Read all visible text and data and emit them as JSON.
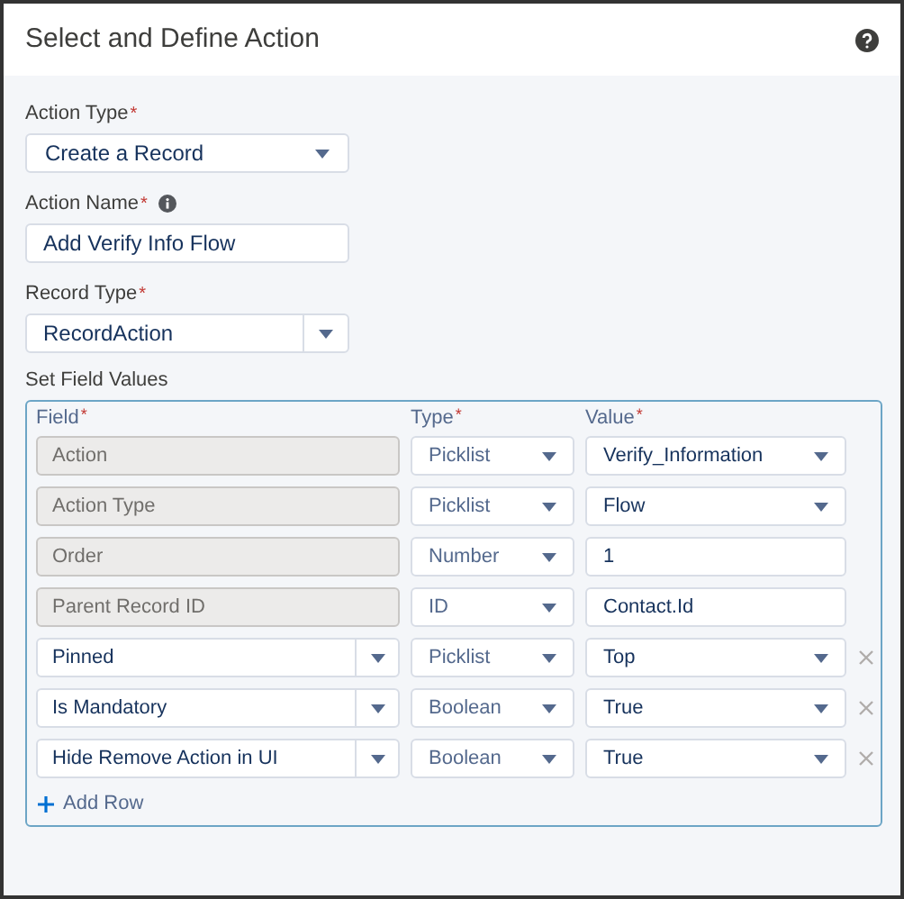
{
  "dialog": {
    "title": "Select and Define Action"
  },
  "action_type": {
    "label": "Action Type",
    "required_mark": "*",
    "value": "Create a Record"
  },
  "action_name": {
    "label": "Action Name",
    "required_mark": "*",
    "value": "Add Verify Info Flow"
  },
  "record_type": {
    "label": "Record Type",
    "required_mark": "*",
    "value": "RecordAction"
  },
  "field_values": {
    "label": "Set Field Values",
    "columns": [
      {
        "label": "Field",
        "required_mark": "*"
      },
      {
        "label": "Type",
        "required_mark": "*"
      },
      {
        "label": "Value",
        "required_mark": "*"
      }
    ],
    "rows": [
      {
        "kind": "select",
        "field": "Action",
        "disabled": true,
        "removable": false,
        "type": "Picklist",
        "value": "Verify_Information"
      },
      {
        "kind": "select",
        "field": "Action Type",
        "disabled": true,
        "removable": false,
        "type": "Picklist",
        "value": "Flow"
      },
      {
        "kind": "text",
        "field": "Order",
        "disabled": true,
        "removable": false,
        "type": "Number",
        "value": "1"
      },
      {
        "kind": "text",
        "field": "Parent Record ID",
        "disabled": true,
        "removable": false,
        "type": "ID",
        "value": "Contact.Id"
      },
      {
        "kind": "select",
        "field": "Pinned",
        "disabled": false,
        "removable": true,
        "type": "Picklist",
        "value": "Top"
      },
      {
        "kind": "select",
        "field": "Is Mandatory",
        "disabled": false,
        "removable": true,
        "type": "Boolean",
        "value": "True"
      },
      {
        "kind": "select",
        "field": "Hide Remove Action in UI",
        "disabled": false,
        "removable": true,
        "type": "Boolean",
        "value": "True"
      }
    ],
    "add_row": "Add Row"
  }
}
